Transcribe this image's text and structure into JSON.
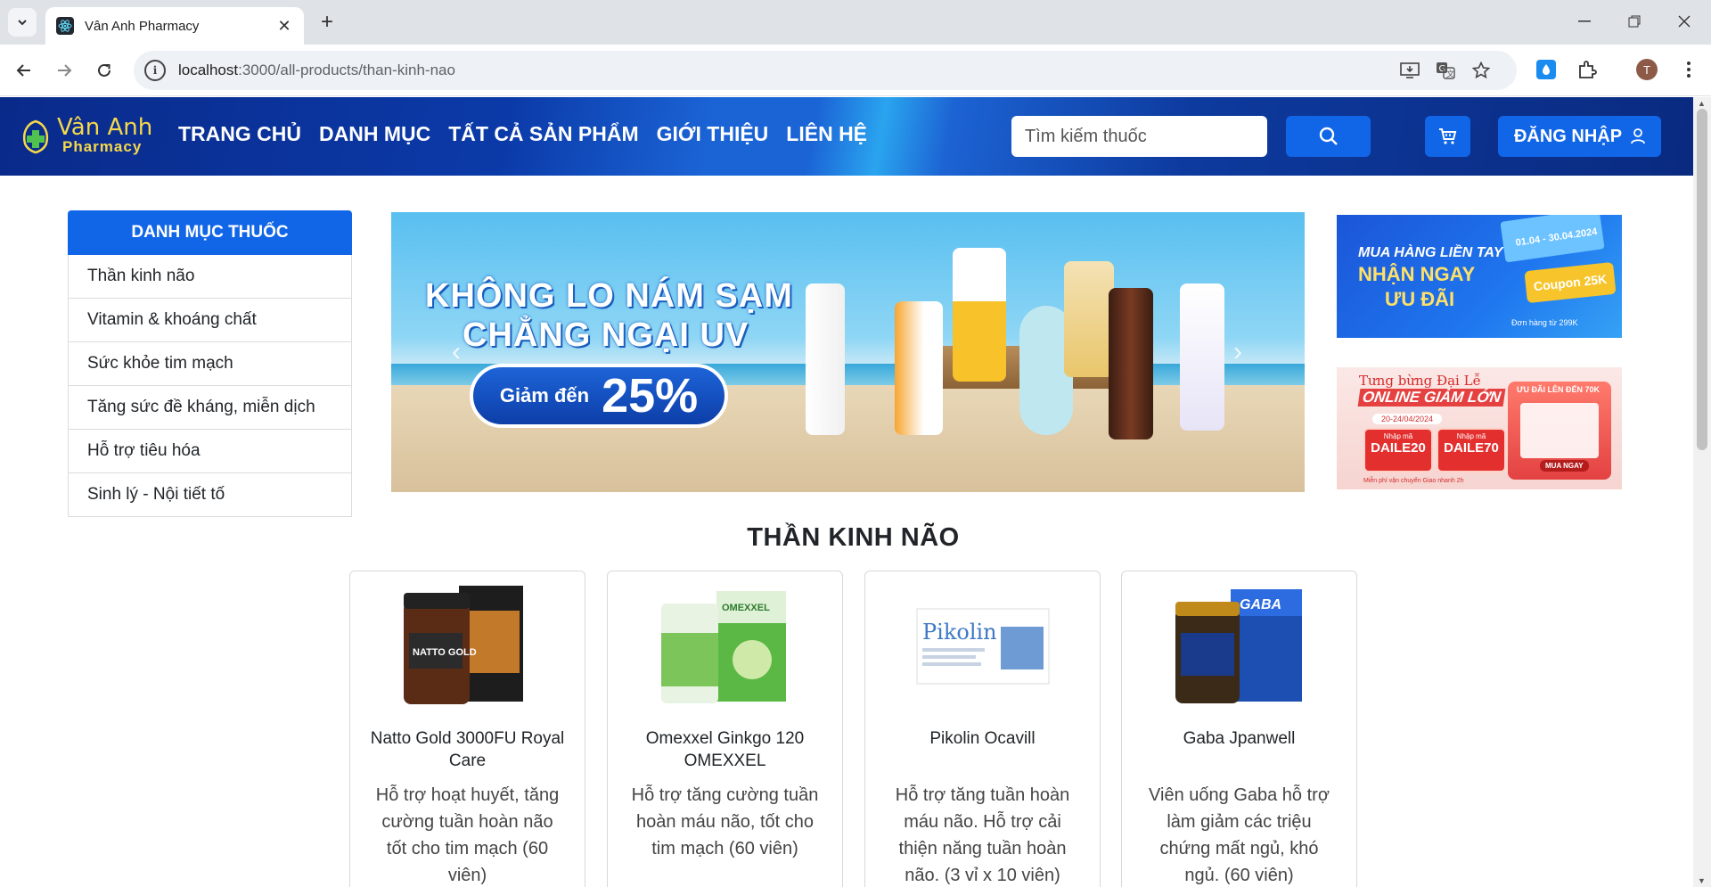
{
  "browser": {
    "tab_title": "Vân Anh Pharmacy",
    "url_host": "localhost",
    "url_path": ":3000/all-products/than-kinh-nao",
    "avatar_letter": "T"
  },
  "header": {
    "logo_line1": "Vân Anh",
    "logo_line2": "Pharmacy",
    "nav": [
      "TRANG CHỦ",
      "DANH MỤC",
      "TẤT CẢ SẢN PHẨM",
      "GIỚI THIỆU",
      "LIÊN HỆ"
    ],
    "search_placeholder": "Tìm kiếm thuốc",
    "login_label": "ĐĂNG NHẬP"
  },
  "sidebar": {
    "heading": "DANH MỤC THUỐC",
    "items": [
      "Thần kinh não",
      "Vitamin & khoáng chất",
      "Sức khỏe tim mạch",
      "Tăng sức đề kháng, miễn dịch",
      "Hỗ trợ tiêu hóa",
      "Sinh lý - Nội tiết tố"
    ]
  },
  "banner": {
    "headline_1": "KHÔNG LO NÁM SẠM",
    "headline_2": "CHẲNG NGẠI UV",
    "discount_small": "Giảm đến",
    "discount_big": "25%"
  },
  "promos": {
    "p1_line1": "MUA HÀNG LIỀN TAY",
    "p1_line2": "NHẬN NGAY",
    "p1_line3": "ƯU ĐÃI",
    "p1_dates": "01.04 - 30.04.2024",
    "p1_coupon": "Coupon 25K",
    "p1_note": "Đơn hàng từ 299K",
    "p2_line1": "Tưng bừng Đại Lễ",
    "p2_line2": "ONLINE GIẢM LỚN",
    "p2_date": "20-24/04/2024",
    "p2_code1_label": "Nhập mã",
    "p2_code1": "DAILE20",
    "p2_code2_label": "Nhập mã",
    "p2_code2": "DAILE70",
    "p2_gift_head": "ƯU ĐÃI LÊN ĐẾN 70K",
    "p2_buy": "MUA NGAY",
    "p2_bottom": "Miễn phí vận chuyển   Giao nhanh 2h"
  },
  "section_title": "THẦN KINH NÃO",
  "products": [
    {
      "name": "Natto Gold 3000FU Royal Care",
      "desc": "Hỗ trợ hoạt huyết, tăng cường tuần hoàn não tốt cho tim mạch (60 viên)"
    },
    {
      "name": "Omexxel Ginkgo 120 OMEXXEL",
      "desc": "Hỗ trợ tăng cường tuần hoàn máu não, tốt cho tim mạch (60 viên)"
    },
    {
      "name": "Pikolin Ocavill",
      "desc": "Hỗ trợ tăng tuần hoàn máu não. Hỗ trợ cải thiện năng tuần hoàn não. (3 vỉ x 10 viên)"
    },
    {
      "name": "Gaba Jpanwell",
      "desc": "Viên uống Gaba hỗ trợ làm giảm các triệu chứng mất ngủ, khó ngủ. (60 viên)"
    }
  ],
  "product_image_labels": [
    "NATTO GOLD",
    "OMEXXEL",
    "Pikolin",
    "GABA"
  ]
}
